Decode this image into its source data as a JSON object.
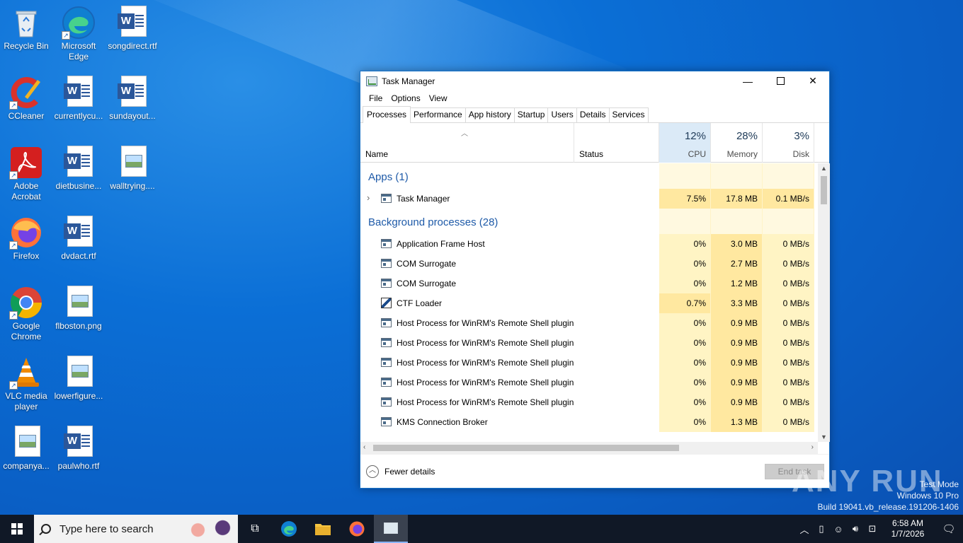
{
  "desktop": {
    "icons": [
      {
        "label": "Recycle Bin",
        "kind": "recycle-bin"
      },
      {
        "label": "Microsoft Edge",
        "kind": "edge"
      },
      {
        "label": "songdirect.rtf",
        "kind": "word"
      },
      {
        "label": "CCleaner",
        "kind": "ccleaner"
      },
      {
        "label": "currentlycu...",
        "kind": "word"
      },
      {
        "label": "sundayout...",
        "kind": "word"
      },
      {
        "label": "Adobe Acrobat",
        "kind": "acrobat"
      },
      {
        "label": "dietbusine...",
        "kind": "word"
      },
      {
        "label": "walltrying....",
        "kind": "image"
      },
      {
        "label": "Firefox",
        "kind": "firefox"
      },
      {
        "label": "dvdact.rtf",
        "kind": "word"
      },
      {
        "label": "Google Chrome",
        "kind": "chrome"
      },
      {
        "label": "flboston.png",
        "kind": "image"
      },
      {
        "label": "VLC media player",
        "kind": "vlc"
      },
      {
        "label": "lowerfigure...",
        "kind": "image"
      },
      {
        "label": "companya...",
        "kind": "image"
      },
      {
        "label": "paulwho.rtf",
        "kind": "word"
      }
    ]
  },
  "task_manager": {
    "title": "Task Manager",
    "menu": [
      "File",
      "Options",
      "View"
    ],
    "tabs": [
      "Processes",
      "Performance",
      "App history",
      "Startup",
      "Users",
      "Details",
      "Services"
    ],
    "active_tab": "Processes",
    "columns": {
      "name": "Name",
      "status": "Status",
      "cpu": {
        "percent": "12%",
        "label": "CPU"
      },
      "memory": {
        "percent": "28%",
        "label": "Memory"
      },
      "disk": {
        "percent": "3%",
        "label": "Disk"
      }
    },
    "groups": {
      "apps": "Apps (1)",
      "background": "Background processes (28)"
    },
    "apps": [
      {
        "name": "Task Manager",
        "cpu": "7.5%",
        "memory": "17.8 MB",
        "disk": "0.1 MB/s"
      }
    ],
    "background": [
      {
        "name": "Application Frame Host",
        "cpu": "0%",
        "memory": "3.0 MB",
        "disk": "0 MB/s"
      },
      {
        "name": "COM Surrogate",
        "cpu": "0%",
        "memory": "2.7 MB",
        "disk": "0 MB/s"
      },
      {
        "name": "COM Surrogate",
        "cpu": "0%",
        "memory": "1.2 MB",
        "disk": "0 MB/s"
      },
      {
        "name": "CTF Loader",
        "cpu": "0.7%",
        "memory": "3.3 MB",
        "disk": "0 MB/s"
      },
      {
        "name": "Host Process for WinRM's Remote Shell plugin",
        "cpu": "0%",
        "memory": "0.9 MB",
        "disk": "0 MB/s"
      },
      {
        "name": "Host Process for WinRM's Remote Shell plugin",
        "cpu": "0%",
        "memory": "0.9 MB",
        "disk": "0 MB/s"
      },
      {
        "name": "Host Process for WinRM's Remote Shell plugin",
        "cpu": "0%",
        "memory": "0.9 MB",
        "disk": "0 MB/s"
      },
      {
        "name": "Host Process for WinRM's Remote Shell plugin",
        "cpu": "0%",
        "memory": "0.9 MB",
        "disk": "0 MB/s"
      },
      {
        "name": "Host Process for WinRM's Remote Shell plugin",
        "cpu": "0%",
        "memory": "0.9 MB",
        "disk": "0 MB/s"
      },
      {
        "name": "KMS Connection Broker",
        "cpu": "0%",
        "memory": "1.3 MB",
        "disk": "0 MB/s"
      }
    ],
    "footer": {
      "fewer_details": "Fewer details",
      "end_task": "End task"
    }
  },
  "watermark": {
    "line1": "Test Mode",
    "line2": "Windows 10 Pro",
    "line3": "Build 19041.vb_release.191206-1406",
    "brand": "ANY RUN"
  },
  "taskbar": {
    "search_placeholder": "Type here to search",
    "time": "6:58 AM",
    "date": "1/7/2026"
  }
}
